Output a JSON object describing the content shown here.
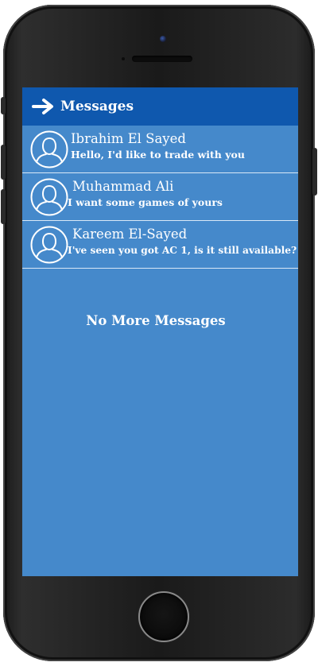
{
  "header": {
    "icon": "arrow-right-icon",
    "title": "Messages"
  },
  "messages": [
    {
      "sender": "Ibrahim El Sayed",
      "preview": "Hello, I'd like to trade with you",
      "avatar_icon": "user-avatar-icon"
    },
    {
      "sender": "Muhammad Ali",
      "preview": "I want some  games of yours",
      "avatar_icon": "user-avatar-icon"
    },
    {
      "sender": "Kareem El-Sayed",
      "preview": "I've seen you got AC 1, is it still available?",
      "avatar_icon": "user-avatar-icon"
    }
  ],
  "empty_state": {
    "text": "No More Messages"
  },
  "colors": {
    "header_bg": "#0f58ae",
    "screen_bg": "#4589cb",
    "text": "#ffffff"
  }
}
